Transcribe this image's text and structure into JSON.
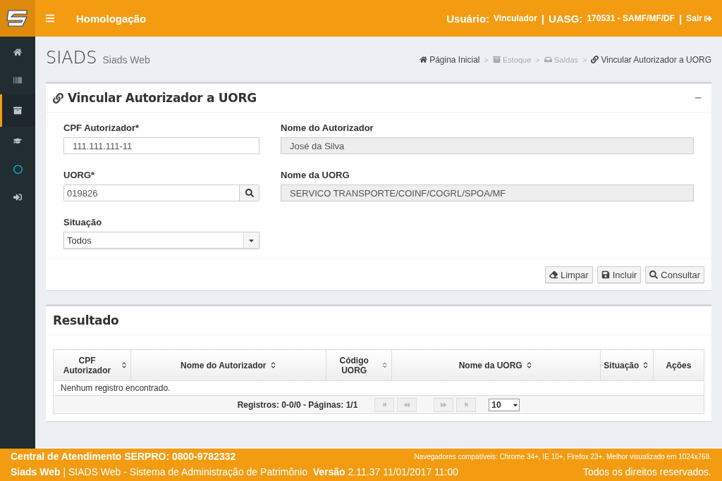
{
  "header": {
    "env": "Homologação",
    "user_label": "Usuário:",
    "user_value": "Vinculador",
    "sep1": "|",
    "uasg_label": "UASG:",
    "uasg_value": "170531 - SAMF/MF/DF",
    "sep2": "|",
    "logout": "Sair"
  },
  "sidebar": {
    "items": [
      {
        "kind": "home",
        "selected": false
      },
      {
        "kind": "barcode",
        "selected": false
      },
      {
        "kind": "archive",
        "selected": true
      },
      {
        "kind": "cap",
        "selected": false
      },
      {
        "kind": "circle",
        "selected": false
      },
      {
        "kind": "signin",
        "selected": false
      }
    ]
  },
  "page": {
    "title": "SIADS",
    "subtitle": "Siads Web"
  },
  "breadcrumb": [
    {
      "kind": "home",
      "label": "Página Inicial",
      "disabled": false
    },
    {
      "kind": "archive",
      "label": "Estoque",
      "disabled": true
    },
    {
      "kind": "tray",
      "label": "Saídas",
      "disabled": true
    },
    {
      "kind": "link",
      "label": "Vincular Autorizador a UORG",
      "disabled": false
    }
  ],
  "separator": ">",
  "form": {
    "title": "Vincular Autorizador a UORG",
    "fields": [
      {
        "kind": "input",
        "label": "CPF Autorizador*",
        "value": "111.111.111-11"
      },
      {
        "kind": "readonly",
        "label": "Nome do Autorizador",
        "value": "José da Silva"
      },
      {
        "kind": "search",
        "label": "UORG*",
        "value": "019826"
      },
      {
        "kind": "readonly",
        "label": "Nome da UORG",
        "value": "SERVICO TRANSPORTE/COINF/COGRL/SPOA/MF"
      },
      {
        "kind": "select",
        "label": "Situação",
        "value": "Todos"
      }
    ],
    "buttons": [
      {
        "kind": "eraser",
        "label": "Limpar"
      },
      {
        "kind": "save",
        "label": "Incluir"
      },
      {
        "kind": "search",
        "label": "Consultar"
      }
    ]
  },
  "results": {
    "title": "Resultado",
    "columns": [
      {
        "label": "CPF Autorizador",
        "sortable": true
      },
      {
        "label": "Nome do Autorizador",
        "sortable": true
      },
      {
        "label": "Código UORG",
        "sortable": true
      },
      {
        "label": "Nome da UORG",
        "sortable": true
      },
      {
        "label": "Situação",
        "sortable": true
      },
      {
        "label": "Ações",
        "sortable": false
      }
    ],
    "empty": "Nenhum registro encontrado.",
    "pager": {
      "info": "Registros: 0-0/0 - Páginas: 1/1",
      "page_size": "10"
    }
  },
  "footer": {
    "contact": "Central de Atendimento SERPRO: 0800-9782332",
    "browsers": "Navegadores compatíveis: Chrome 34+, IE 10+, Firefox 23+. Melhor visualizado em 1024x768.",
    "system": "**Siads Web** | SIADS Web - Sistema de Administração de Patrimônio  **Versão** 2.11.37 11/01/2017 11:00",
    "rights": "Todos os direitos reservados."
  }
}
